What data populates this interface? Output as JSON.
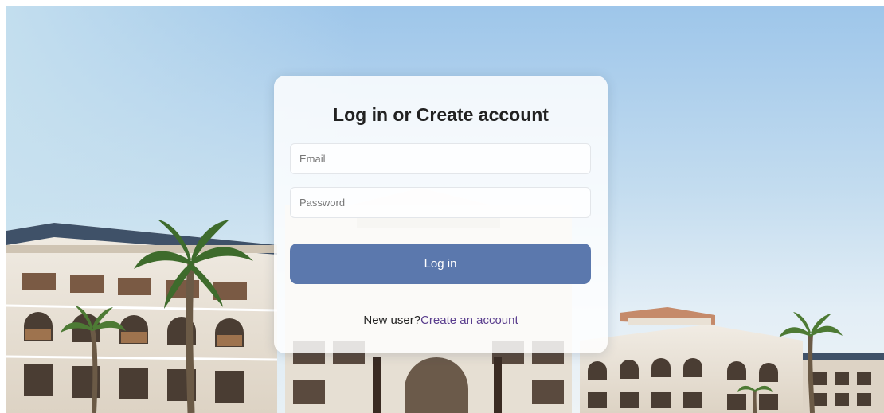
{
  "background": {
    "description_icon": "hotel-resort-photo"
  },
  "login": {
    "title": "Log in or Create account",
    "email_placeholder": "Email",
    "email_value": "",
    "password_placeholder": "Password",
    "password_value": "",
    "submit_label": "Log in",
    "new_user_text": "New user?",
    "create_account_link": "Create an account"
  },
  "colors": {
    "primary_button": "#5b78ad",
    "link": "#5a3e8e",
    "title_text": "#222222"
  }
}
